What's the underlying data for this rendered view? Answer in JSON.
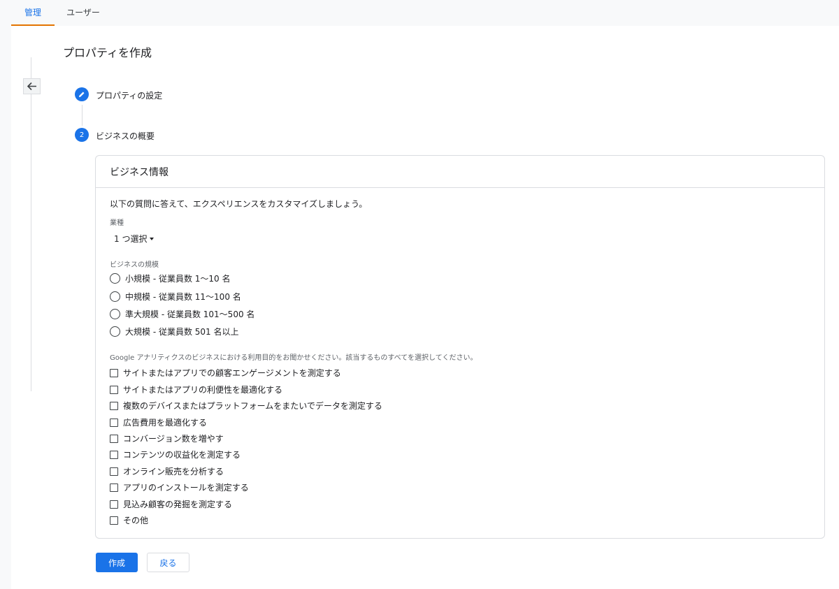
{
  "tabs": [
    {
      "label": "管理"
    },
    {
      "label": "ユーザー"
    }
  ],
  "page": {
    "title": "プロパティを作成"
  },
  "steps": [
    {
      "number": "",
      "icon": "pencil-icon",
      "label": "プロパティの設定"
    },
    {
      "number": "2",
      "label": "ビジネスの概要"
    }
  ],
  "card": {
    "title": "ビジネス情報",
    "intro": "以下の質問に答えて、エクスペリエンスをカスタマイズしましょう。",
    "industry": {
      "label": "業種",
      "selected": "1 つ選択"
    },
    "size": {
      "label": "ビジネスの規模",
      "options": [
        "小規模 - 従業員数 1〜10 名",
        "中規模 - 従業員数 11〜100 名",
        "準大規模 - 従業員数 101〜500 名",
        "大規模 - 従業員数 501 名以上"
      ]
    },
    "usage": {
      "label": "Google アナリティクスのビジネスにおける利用目的をお聞かせください。該当するものすべてを選択してください。",
      "options": [
        "サイトまたはアプリでの顧客エンゲージメントを測定する",
        "サイトまたはアプリの利便性を最適化する",
        "複数のデバイスまたはプラットフォームをまたいでデータを測定する",
        "広告費用を最適化する",
        "コンバージョン数を増やす",
        "コンテンツの収益化を測定する",
        "オンライン販売を分析する",
        "アプリのインストールを測定する",
        "見込み顧客の発掘を測定する",
        "その他"
      ]
    }
  },
  "buttons": {
    "create": "作成",
    "back": "戻る"
  },
  "colors": {
    "primary": "#1a73e8",
    "tab_indicator": "#e37400",
    "border": "#dadce0"
  }
}
